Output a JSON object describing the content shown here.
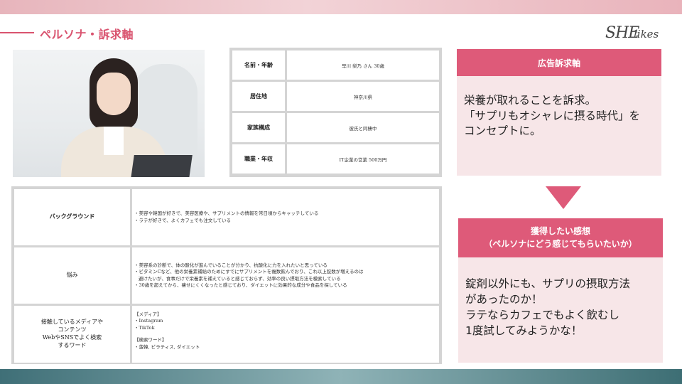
{
  "header": {
    "title": "ペルソナ・訴求軸",
    "logo_she": "SHE",
    "logo_likes": "likes"
  },
  "profile": [
    {
      "label": "名前・年齢",
      "value": "早川 梨乃 さん 30歳"
    },
    {
      "label": "居住地",
      "value": "神奈川県"
    },
    {
      "label": "家族構成",
      "value": "彼氏と同棲中"
    },
    {
      "label": "職業・年収",
      "value": "IT企業の営業 500万円"
    }
  ],
  "details": {
    "background": {
      "label": "バックグラウンド",
      "lines": [
        "・美容や韓国が好きで、美容医療や、サプリメントの情報を常日頃からキャッチしている",
        "・ラテが好きで、よくカフェでも注文している"
      ]
    },
    "worries": {
      "label": "悩み",
      "lines": [
        "・美容系の診断で、体の酸化が進んでいることが分かり、抗酸化に力を入れたいと思っている",
        "・ビタミンCなど、他の栄養素補給のためにすでにサプリメントを複数飲んでおり、これ以上錠数が増えるのは",
        "避けたいが、食事だけで栄養素を補えていると感じておらず、効率の良い摂取方法を模索している",
        "・30歳を超えてから、痩せにくくなったと感じており、ダイエットに効果的な成分や食品を探している"
      ]
    },
    "media": {
      "label_lines": [
        "接触しているメディアや",
        "コンテンツ",
        "WebやSNSでよく検索",
        "するワード"
      ],
      "media_header": "【メディア】",
      "media_items": [
        "・Instagram",
        "・TikTok"
      ],
      "search_header": "【検索ワード】",
      "search_items": [
        "・菠韓, ビラティス, ダイエット"
      ]
    }
  },
  "appeal": {
    "header": "広告訴求軸",
    "lines": [
      "栄養が取れることを訴求。",
      "「サプリもオシャレに摂る時代」を",
      "コンセプトに。"
    ]
  },
  "feeling": {
    "header_line1": "獲得したい感想",
    "header_line2": "（ペルソナにどう感じてもらいたいか）",
    "lines": [
      "錠剤以外にも、サプリの摂取方法",
      "があったのか！",
      "ラテならカフェでもよく飲むし",
      "1度試してみようかな！"
    ]
  },
  "colors": {
    "accent": "#de5a79",
    "accent_light": "#f7e6e8",
    "title": "#d9536f",
    "footer": "#3f6f77"
  }
}
